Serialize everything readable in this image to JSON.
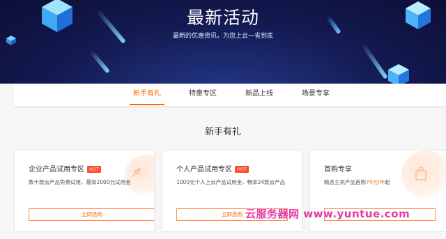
{
  "banner": {
    "title": "最新活动",
    "subtitle": "最新的优惠资讯，为您上云一省到底"
  },
  "tabs": [
    {
      "label": "新手有礼",
      "active": true
    },
    {
      "label": "特惠专区",
      "active": false
    },
    {
      "label": "新品上线",
      "active": false
    },
    {
      "label": "场景专享",
      "active": false
    }
  ],
  "section": {
    "title": "新手有礼"
  },
  "cards": [
    {
      "title": "企业产品试用专区",
      "badge": "HOT",
      "desc": "数十款云产品免费试用，最高2000元试用金",
      "button": "立即选购",
      "icon": "rocket-icon"
    },
    {
      "title": "个人产品试用专区",
      "badge": "HOT",
      "desc": "1000元个人上云产品试用金，畅享24款云产品",
      "button": "立即选购",
      "icon": "gift-icon"
    },
    {
      "title": "首购专享",
      "desc_prefix": "精选主机产品首购",
      "desc_price": "74元/年",
      "desc_suffix": "起",
      "icon": "shopping-bag-icon"
    }
  ],
  "watermark": "云服务器网 www.yuntue.com",
  "colors": {
    "accent": "#ff6a00",
    "hot": "#ff4b2b",
    "banner": "#141a52"
  }
}
